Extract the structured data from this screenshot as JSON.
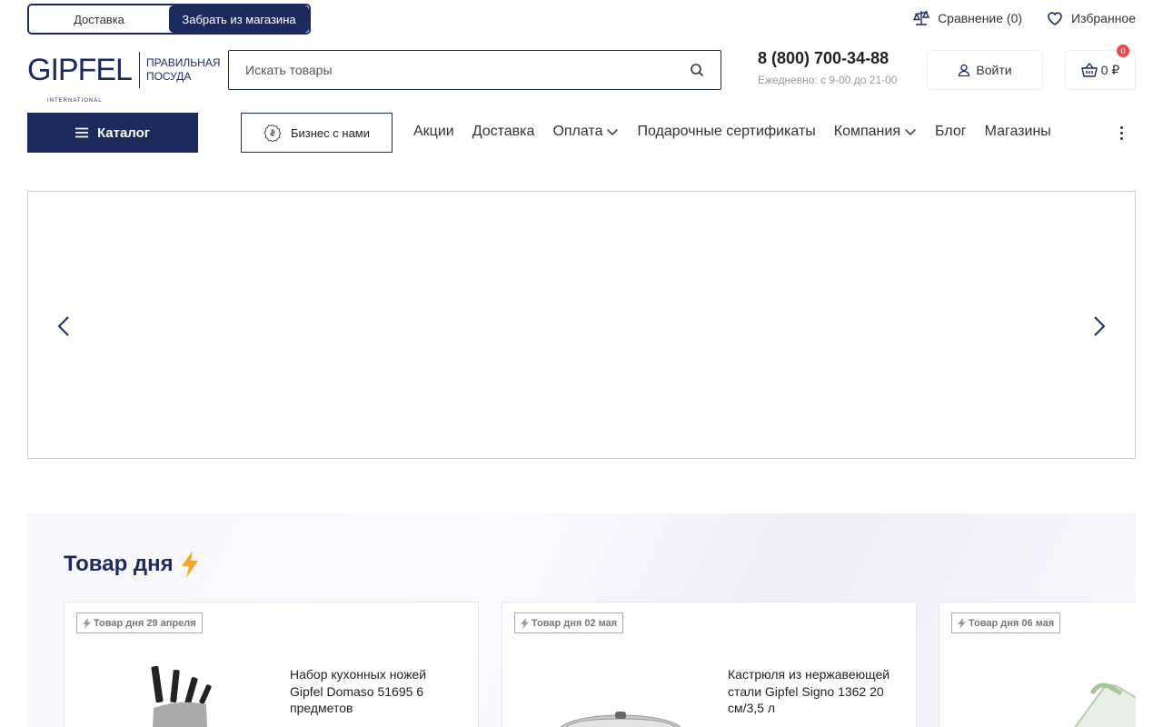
{
  "topbar": {
    "delivery_options": [
      "Доставка",
      "Забрать из магазина"
    ],
    "compare_label": "Сравнение (0)",
    "favorites_label": "Избранное"
  },
  "header": {
    "logo_text": "GIPFEL",
    "logo_sub": "INTERNATIONAL",
    "logo_tagline_1": "ПРАВИЛЬНАЯ",
    "logo_tagline_2": "ПОСУДА",
    "search_placeholder": "Искать товары",
    "phone": "8 (800) 700-34-88",
    "hours": "Ежедневно: с 9-00 до 21-00",
    "login_label": "Войти",
    "cart_total": "0 ₽",
    "cart_count": "0"
  },
  "nav": {
    "catalog_label": "Каталог",
    "business_label": "Бизнес с нами",
    "items": [
      "Акции",
      "Доставка",
      "Оплата",
      "Подарочные сертификаты",
      "Компания",
      "Блог",
      "Магазины"
    ]
  },
  "potd": {
    "title": "Товар дня",
    "cards": [
      {
        "tag": "Товар дня 29 апреля",
        "name": "Набор кухонных ножей Gipfel Domaso 51695 6 предметов"
      },
      {
        "tag": "Товар дня 02 мая",
        "name": "Кастрюля из нержавеющей стали Gipfel Signo 1362 20 см/3,5 л"
      },
      {
        "tag": "Товар дня 06 мая",
        "name": ""
      }
    ]
  },
  "colors": {
    "brand": "#1d2a5e",
    "badge": "#e94b4b",
    "lightning": "#f5a623"
  }
}
